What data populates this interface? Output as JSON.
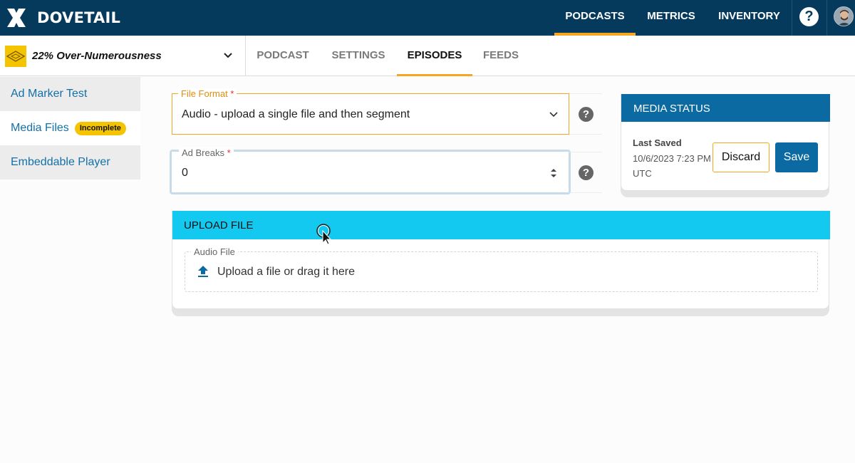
{
  "app": {
    "brand": "DOVETAIL",
    "brand_color": "#063a5c",
    "accent_color": "#f5a623"
  },
  "topnav": {
    "items": [
      {
        "label": "PODCASTS",
        "active": true
      },
      {
        "label": "METRICS",
        "active": false
      },
      {
        "label": "INVENTORY",
        "active": false
      }
    ],
    "help_label": "?",
    "help_icon": "question-circle-icon",
    "avatar_icon": "user-avatar"
  },
  "podcast": {
    "name": "22% Over-Numerousness",
    "selector_icon": "chevron-down-icon"
  },
  "tabs": [
    {
      "label": "PODCAST",
      "active": false
    },
    {
      "label": "SETTINGS",
      "active": false
    },
    {
      "label": "EPISODES",
      "active": true
    },
    {
      "label": "FEEDS",
      "active": false
    }
  ],
  "sidebar": {
    "items": [
      {
        "label": "Ad Marker Test"
      },
      {
        "label": "Media Files",
        "badge": "Incomplete"
      },
      {
        "label": "Embeddable Player"
      }
    ]
  },
  "form": {
    "file_format": {
      "label": "File Format",
      "required_mark": "*",
      "value": "Audio - upload a single file and then segment",
      "help": "?"
    },
    "ad_breaks": {
      "label": "Ad Breaks",
      "required_mark": "*",
      "value": "0",
      "help": "?"
    }
  },
  "media_status": {
    "title": "MEDIA STATUS",
    "last_saved_label": "Last Saved",
    "last_saved_value": "10/6/2023 7:23 PM UTC",
    "discard_label": "Discard",
    "save_label": "Save"
  },
  "upload": {
    "title": "UPLOAD FILE",
    "field_label": "Audio File",
    "prompt": "Upload a file or drag it here",
    "icon": "upload-icon"
  }
}
